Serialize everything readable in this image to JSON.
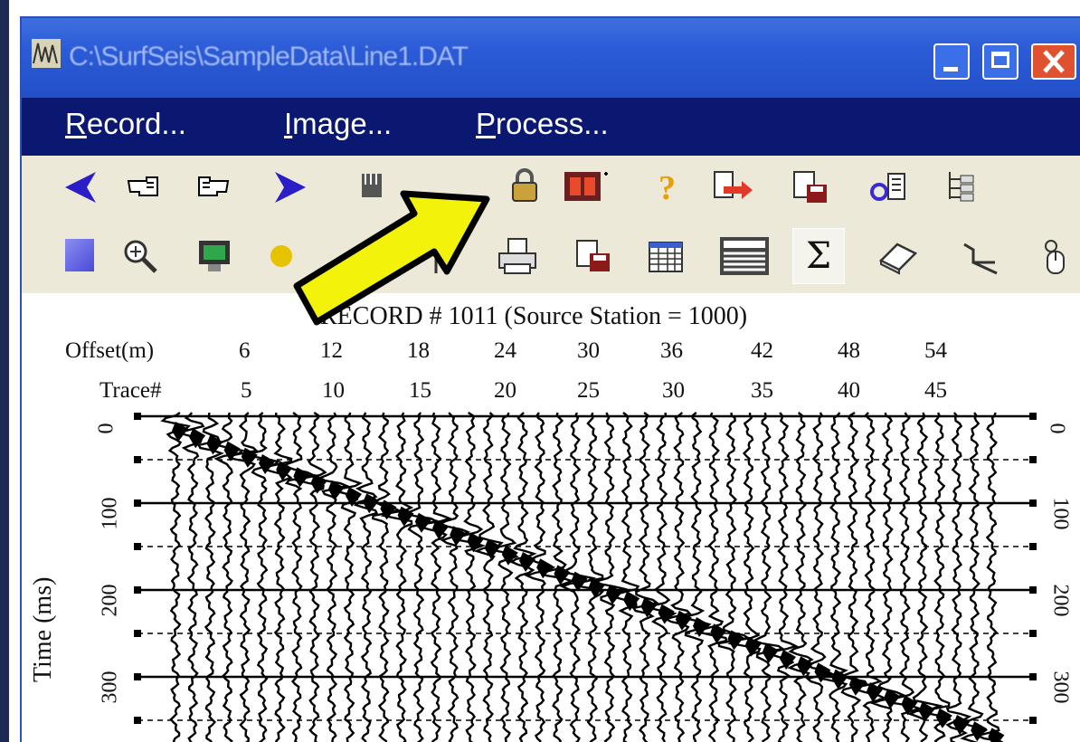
{
  "window": {
    "title": "C:\\SurfSeis\\SampleData\\Line1.DAT",
    "controls": {
      "minimize": "minimize",
      "maximize": "maximize",
      "close": "close"
    }
  },
  "menu": {
    "items": [
      {
        "key": "R",
        "rest": "ecord..."
      },
      {
        "key": "I",
        "rest": "mage..."
      },
      {
        "key": "P",
        "rest": "rocess..."
      }
    ]
  },
  "toolbar1": {
    "icons": [
      "previous-arrow-icon",
      "hand-left-icon",
      "hand-right-icon",
      "next-arrow-icon",
      "hand-icon",
      "lock-icon",
      "film-icon",
      "help-icon",
      "export-icon",
      "save-record-icon",
      "tools-icon",
      "tree-icon"
    ]
  },
  "toolbar2": {
    "icons": [
      "blue-square-icon",
      "zoom-icon",
      "monitor-icon",
      "palette-icon",
      "page-icon",
      "cursor-icon",
      "printer-icon",
      "save-icon",
      "grid-icon",
      "spreadsheet-icon",
      "sum-icon",
      "eraser-icon",
      "crop-icon",
      "mouse-icon"
    ],
    "sum_glyph": "Σ"
  },
  "plot": {
    "record_title": "RECORD # 1011 (Source Station = 1000)",
    "offset_label": "Offset(m)",
    "offsets": [
      "6",
      "12",
      "18",
      "24",
      "30",
      "36",
      "42",
      "48",
      "54"
    ],
    "trace_label": "Trace#",
    "traces": [
      "5",
      "10",
      "15",
      "20",
      "25",
      "30",
      "35",
      "40",
      "45"
    ],
    "time_label": "Time (ms)",
    "time_ticks": [
      "0",
      "100",
      "200",
      "300"
    ]
  },
  "colors": {
    "titlebar": "#2b5bd6",
    "menubar": "#0b1872",
    "arrow": "#f2f20a"
  }
}
